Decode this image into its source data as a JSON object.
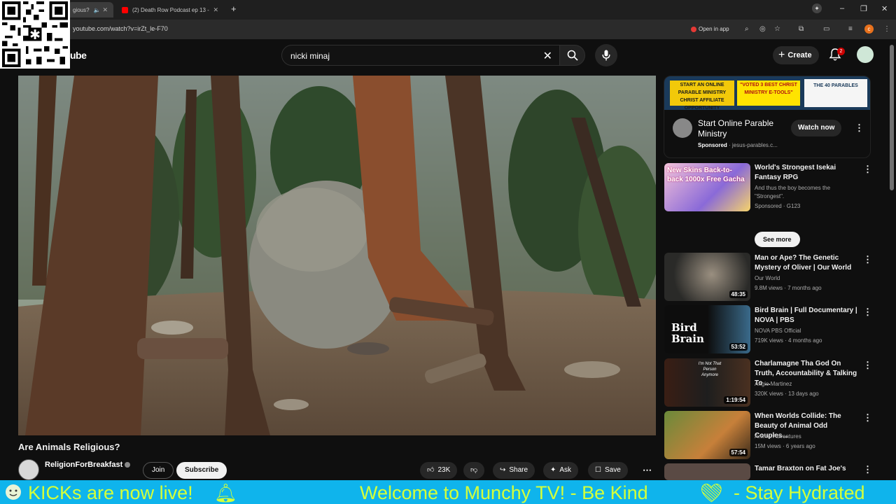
{
  "browser": {
    "tabs": [
      {
        "label": "gious?",
        "active": true
      },
      {
        "label": "(2) Death Row Podcast ep 13 -",
        "active": false
      }
    ],
    "url": "youtube.com/watch?v=irZt_le-F70",
    "open_in_app": "Open in app",
    "profile_initial": "c"
  },
  "youtube": {
    "logo_text": "ube",
    "search_value": "nicki minaj",
    "create_label": "Create",
    "notifications_count": "2"
  },
  "video": {
    "title": "Are Animals Religious?",
    "channel": "ReligionForBreakfast",
    "join_label": "Join",
    "subscribe_label": "Subscribe",
    "likes": "23K",
    "share_label": "Share",
    "ask_label": "Ask",
    "save_label": "Save"
  },
  "ad": {
    "banner_1": "START AN ONLINE PARABLE MINISTRY CHRIST AFFILIATE OPPORTUNITY",
    "banner_2": "\"VOTED 3 BEST CHRIST MINISTRY E-TOOLS\"",
    "banner_3": "THE 40 PARABLES",
    "title": "Start Online Parable Ministry",
    "sponsored": "Sponsored",
    "domain": "· jesus-parables.c...",
    "cta": "Watch now"
  },
  "related": [
    {
      "title": "World's Strongest Isekai Fantasy RPG",
      "desc": "And thus the boy becomes the \"Strongest\".",
      "meta": "Sponsored · G123",
      "duration": "",
      "cta": "See more",
      "thumb_text": "New Skins Back-to-back 1000x Free Gacha"
    },
    {
      "title": "Man or Ape? The Genetic Mystery of Oliver | Our World",
      "channel": "Our World",
      "meta": "9.8M views · 7 months ago",
      "duration": "48:35"
    },
    {
      "title": "Bird Brain | Full Documentary | NOVA | PBS",
      "channel": "NOVA PBS Official",
      "meta": "719K views · 4 months ago",
      "duration": "53:52",
      "thumb_text": "Bird Brain"
    },
    {
      "title": "Charlamagne Tha God On Truth, Accountability & Talking To ...",
      "channel": "Angie Martinez",
      "meta": "320K views · 13 days ago",
      "duration": "1:19:54",
      "thumb_text": "I'm Not That Person Anymore"
    },
    {
      "title": "When Worlds Collide: The Beauty of Animal Odd Couples...",
      "channel": "Animal Adventures",
      "meta": "15M views · 6 years ago",
      "duration": "57:54"
    },
    {
      "title": "Tamar Braxton on Fat Joe's",
      "channel": "",
      "meta": "",
      "duration": ""
    }
  ],
  "ticker": {
    "text_left": "KICKs are now live!",
    "text_right": "Welcome to Munchy TV!  - Be Kind",
    "text_right2": "- Stay Hydrated"
  },
  "colors": {
    "ticker_bg": "#0fb4ec",
    "ticker_text": "#d4ff3a",
    "yt_red": "#ff0000"
  }
}
